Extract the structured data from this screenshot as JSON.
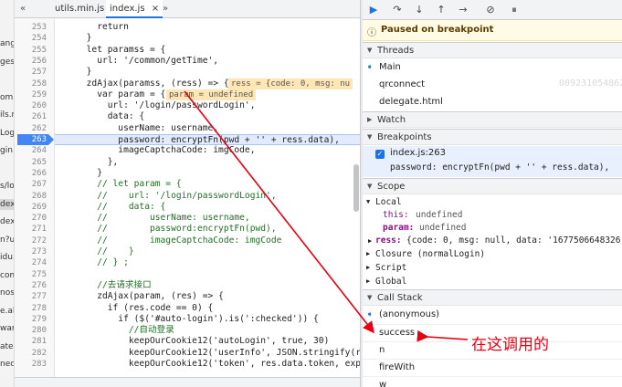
{
  "left_panel": {
    "items": [
      "ang",
      "ges",
      "",
      "omr",
      "ils.n",
      "Logi",
      "gin.",
      "",
      "s/lo",
      "dex",
      "dex",
      "n?u",
      "idu.",
      "com",
      "nos",
      "e.al",
      "wan",
      "ate.l",
      "nect"
    ],
    "selected_index": 9
  },
  "tabs": {
    "back_glyph": "«",
    "file1": "utils.min.js",
    "file2": "index.js",
    "close_glyph": "×",
    "more_glyph": "»"
  },
  "line_numbers": [
    "253",
    "254",
    "255",
    "256",
    "257",
    "258",
    "259",
    "260",
    "261",
    "262",
    "263",
    "264",
    "265",
    "266",
    "267",
    "268",
    "269",
    "270",
    "271",
    "272",
    "273",
    "274",
    "275",
    "276",
    "277",
    "278",
    "279",
    "280",
    "281",
    "282",
    "283"
  ],
  "breakpoint_line": "263",
  "code_lines": [
    "        return",
    "      }",
    "      let paramss = {",
    "        url: '/common/getTime',",
    "      }",
    "      zdAjax(paramss, (ress) => {",
    "        var param = {",
    "          url: '/login/passwordLogin',",
    "          data: {",
    "            userName: username,",
    "            password: encryptFn(pwd + '' + ress.data),",
    "            imageCaptchaCode: imgCode,",
    "          },",
    "        }",
    "        // let param = {",
    "        //    url: '/login/passwordLogin',",
    "        //    data: {",
    "        //        userName: username,",
    "        //        password:encryptFn(pwd),",
    "        //        imageCaptchaCode: imgCode",
    "        //    }",
    "        // } ;",
    "",
    "        //去请求接口",
    "        zdAjax(param, (res) => {",
    "          if (res.code == 0) {",
    "            if ($('#auto-login').is(':checked')) {",
    "              //自动登录",
    "              keepOurCookie12('autoLogin', true, 30)",
    "              keepOurCookie12('userInfo', JSON.stringify(re",
    "              keepOurCookie12('token', res.data.token, expi"
  ],
  "inline_values": {
    "ress": "ress = {code: 0, msg: nu",
    "param": "param = undefined"
  },
  "paused_text": "Paused on breakpoint",
  "threads": {
    "header": "Threads",
    "items": [
      "Main",
      "qrconnect",
      "delegate.html"
    ]
  },
  "watch": {
    "header": "Watch"
  },
  "breakpoints": {
    "header": "Breakpoints",
    "file": "index.js:263",
    "code": "password: encryptFn(pwd + '' + ress.data),"
  },
  "scope": {
    "header": "Scope",
    "local_header": "Local",
    "this_key": "this:",
    "this_val": "undefined",
    "param_key": "param:",
    "param_val": "undefined",
    "ress_key": "ress:",
    "ress_val": "{code: 0, msg: null, data: '1677506648326",
    "closure": "Closure (normalLogin)",
    "script": "Script",
    "global": "Global"
  },
  "call_stack": {
    "header": "Call Stack",
    "items": [
      "(anonymous)",
      "success",
      "n",
      "fireWith",
      "w"
    ]
  },
  "annotation": "在这调用的",
  "watermark": "0092310548620",
  "colors": {
    "accent": "#1a73e8",
    "breakpoint_line": "#4285f4",
    "annotation": "#e60012",
    "paused_bg": "#fffbe5"
  }
}
